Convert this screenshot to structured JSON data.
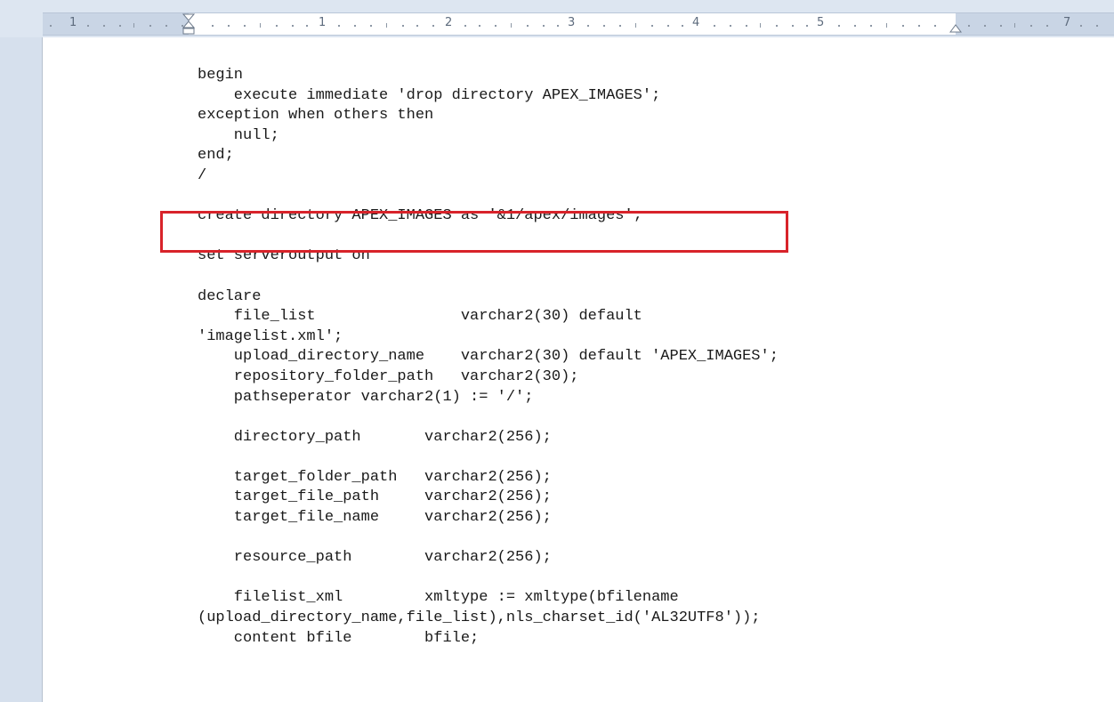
{
  "ruler": {
    "labels": [
      "1",
      "1",
      "2",
      "3",
      "4",
      "5",
      "7"
    ]
  },
  "document": {
    "code_lines": [
      "begin",
      "    execute immediate 'drop directory APEX_IMAGES';",
      "exception when others then",
      "    null;",
      "end;",
      "/",
      "",
      "create directory APEX_IMAGES as '&1/apex/images';",
      "",
      "set serveroutput on",
      "",
      "declare",
      "    file_list                varchar2(30) default",
      "'imagelist.xml';",
      "    upload_directory_name    varchar2(30) default 'APEX_IMAGES';",
      "    repository_folder_path   varchar2(30);",
      "    pathseperator varchar2(1) := '/';",
      "",
      "    directory_path       varchar2(256);",
      "",
      "    target_folder_path   varchar2(256);",
      "    target_file_path     varchar2(256);",
      "    target_file_name     varchar2(256);",
      "",
      "    resource_path        varchar2(256);",
      "",
      "    filelist_xml         xmltype := xmltype(bfilename",
      "(upload_directory_name,file_list),nls_charset_id('AL32UTF8'));",
      "    content bfile        bfile;"
    ]
  },
  "colors": {
    "highlight_border": "#d8232a",
    "ruler_margin": "#c9d5e5",
    "background": "#d7e1ee"
  }
}
